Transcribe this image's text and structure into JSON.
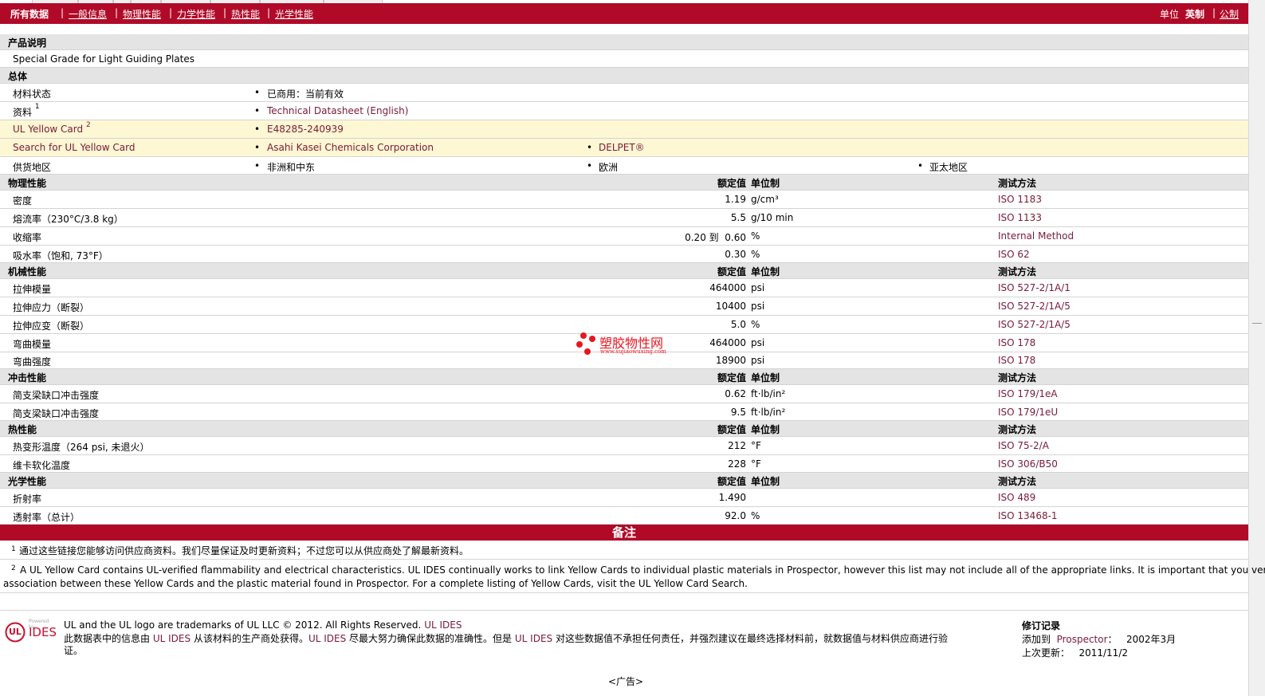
{
  "nav": {
    "left": [
      "所有数据",
      "一般信息",
      "物理性能",
      "力学性能",
      "热性能",
      "光学性能"
    ],
    "units_label": "单位",
    "imperial": "英制",
    "metric": "公制"
  },
  "product": {
    "section_title": "产品说明",
    "description": "Special Grade for Light Guiding Plates"
  },
  "general": {
    "section_title": "总体",
    "rows": [
      {
        "label": "材料状态",
        "values": [
          "已商用：当前有效"
        ]
      },
      {
        "label": "资料",
        "sup": "1",
        "values": [
          "Technical Datasheet (English)"
        ]
      },
      {
        "label": "UL Yellow Card",
        "sup": "2",
        "values": [
          "E48285-240939"
        ]
      },
      {
        "label": "Search for UL Yellow Card",
        "values": [
          "Asahi Kasei Chemicals Corporation",
          "DELPET®"
        ]
      },
      {
        "label": "供货地区",
        "values": [
          "非洲和中东",
          "欧洲",
          "亚太地区"
        ]
      }
    ]
  },
  "col_headers": {
    "nominal": "额定值",
    "unit": "单位制",
    "method": "测试方法"
  },
  "physical": {
    "section_title": "物理性能",
    "rows": [
      {
        "label": "密度",
        "value": "1.19",
        "unit": "g/cm³",
        "method": "ISO 1183"
      },
      {
        "label": "熔流率（230°C/3.8 kg）",
        "value": "5.5",
        "unit": "g/10 min",
        "method": "ISO 1133"
      },
      {
        "label": "收缩率",
        "value": "0.20 到  0.60",
        "unit": "%",
        "method": "Internal Method"
      },
      {
        "label": "吸水率（饱和, 73°F）",
        "value": "0.30",
        "unit": "%",
        "method": "ISO 62"
      }
    ]
  },
  "mechanical": {
    "section_title": "机械性能",
    "rows": [
      {
        "label": "拉伸模量",
        "value": "464000",
        "unit": "psi",
        "method": "ISO 527-2/1A/1"
      },
      {
        "label": "拉伸应力（断裂）",
        "value": "10400",
        "unit": "psi",
        "method": "ISO 527-2/1A/5"
      },
      {
        "label": "拉伸应变（断裂）",
        "value": "5.0",
        "unit": "%",
        "method": "ISO 527-2/1A/5"
      },
      {
        "label": "弯曲模量",
        "value": "464000",
        "unit": "psi",
        "method": "ISO 178"
      },
      {
        "label": "弯曲强度",
        "value": "18900",
        "unit": "psi",
        "method": "ISO 178"
      }
    ]
  },
  "impact": {
    "section_title": "冲击性能",
    "rows": [
      {
        "label": "简支梁缺口冲击强度",
        "value": "0.62",
        "unit": "ft·lb/in²",
        "method": "ISO 179/1eA"
      },
      {
        "label": "简支梁缺口冲击强度",
        "value": "9.5",
        "unit": "ft·lb/in²",
        "method": "ISO 179/1eU"
      }
    ]
  },
  "thermal": {
    "section_title": "热性能",
    "rows": [
      {
        "label": "热变形温度（264 psi, 未退火）",
        "value": "212",
        "unit": "°F",
        "method": "ISO 75-2/A"
      },
      {
        "label": "维卡软化温度",
        "value": "228",
        "unit": "°F",
        "method": "ISO 306/B50"
      }
    ]
  },
  "optical": {
    "section_title": "光学性能",
    "rows": [
      {
        "label": "折射率",
        "value": "1.490",
        "unit": "",
        "method": "ISO 489"
      },
      {
        "label": "透射率（总计）",
        "value": "92.0",
        "unit": "%",
        "method": "ISO 13468-1"
      }
    ]
  },
  "notes": {
    "title": "备注",
    "fn1_num": "1",
    "fn1": "通过这些链接您能够访问供应商资料。我们尽量保证及时更新资料；不过您可以从供应商处了解最新资料。",
    "fn2_num": "2",
    "fn2_line1": "A UL Yellow Card contains UL-verified flammability and electrical characteristics. UL IDES continually works to link Yellow Cards to individual plastic materials in Prospector, however this list may not include all of the appropriate links. It is important that you verify the",
    "fn2_line2": "association between these Yellow Cards and the plastic material found in Prospector. For a complete listing of Yellow Cards, visit the UL Yellow Card Search."
  },
  "watermark": {
    "name": "塑胶物性网",
    "url": "www.sujiaowuxing.com"
  },
  "footer": {
    "logo_powered": "Powered by",
    "logo_ul": "UL",
    "logo_ides": "IDES",
    "trademark": "UL and the UL logo are trademarks of UL LLC © 2012. All Rights Reserved.",
    "trademark_link": "UL IDES",
    "disclaimer_a": "此数据表中的信息由",
    "disclaimer_link1": "UL IDES",
    "disclaimer_b": "从该材料的生产商处获得。",
    "disclaimer_link2": "UL IDES",
    "disclaimer_c": "尽最大努力确保此数据的准确性。但是",
    "disclaimer_link3": "UL IDES",
    "disclaimer_d": "对这些数据值不承担任何责任，并强烈建议在最终选择材料前，就数据值与材料供应商进行验",
    "disclaimer_e": "证。",
    "rev_title": "修订记录",
    "added_label": "添加到",
    "added_link": "Prospector",
    "added_sep": "：",
    "added_date": "2002年3月",
    "updated_label": "上次更新：",
    "updated_date": "2011/11/2",
    "ad": "<广告>"
  },
  "colors": {
    "brand": "#b00a28",
    "link": "#7a1a36",
    "section_bg": "#e4e4e4",
    "yellow_bg": "#fdf7d4"
  }
}
